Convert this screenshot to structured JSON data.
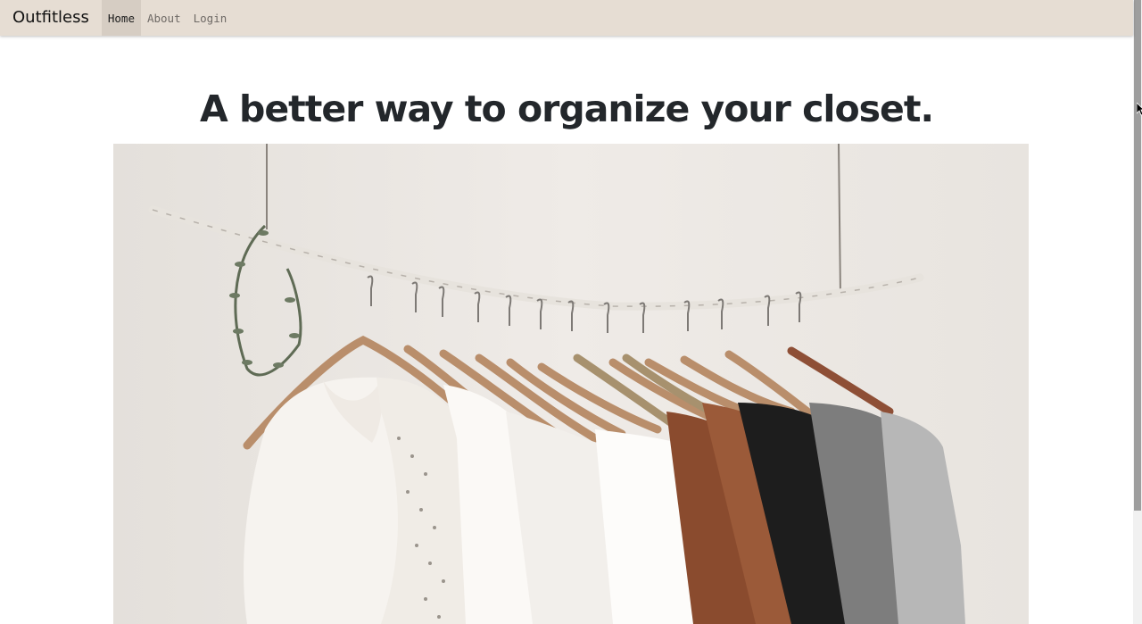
{
  "navbar": {
    "brand": "Outfitless",
    "links": [
      {
        "label": "Home",
        "active": true
      },
      {
        "label": "About",
        "active": false
      },
      {
        "label": "Login",
        "active": false
      }
    ]
  },
  "hero": {
    "title": "A better way to organize your closet.",
    "image": "clothes-rack-photo"
  },
  "colors": {
    "navbar_bg": "#e6ddd3",
    "active_link_bg": "#d6cdc3",
    "title": "#23272b"
  }
}
